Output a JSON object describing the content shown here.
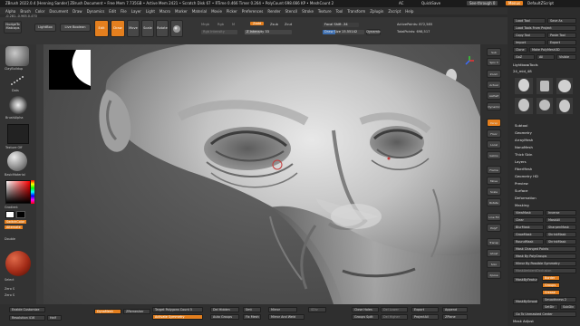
{
  "title_bar": {
    "text": "ZBrush 2022.0.4 [Henning Sander]   ZBrush Document   • Free Mem 7.735GB • Active Mem 2421 • Scratch Disk 67 • RTime 0.466 Timer 0.264 • PolyCount 698.666 KP • MeshCount 2",
    "ac": "AC",
    "quicksave": "QuickSave",
    "see_through": "See-through 0",
    "menus": "Menus",
    "default_script": "DefaultZScript"
  },
  "menu_bar": [
    "Alpha",
    "Brush",
    "Color",
    "Document",
    "Draw",
    "Dynamics",
    "Edit",
    "File",
    "Layer",
    "Light",
    "Macro",
    "Marker",
    "Material",
    "Movie",
    "Picker",
    "Preferences",
    "Render",
    "Stencil",
    "Stroke",
    "Texture",
    "Tool",
    "Transform",
    "Zplugin",
    "Zscript",
    "Help"
  ],
  "status_line": "-0.281,-0.965,0.470",
  "shelf": {
    "nudge_button": "NudgeTo Matcaps",
    "lightbox": "LightBox",
    "live_boolean": "Live Boolean",
    "edit": "Edit",
    "draw": "Draw",
    "move": "Move",
    "scale": "Scale",
    "rotate": "Rotate",
    "mrgb": "Mrgb",
    "rgb": "Rgb",
    "m": "M",
    "zadd": "Zadd",
    "zsub": "Zsub",
    "zcut": "Zcut",
    "rgb_intensity": "Rgb Intensity",
    "z_intensity": "Z Intensity 33",
    "focal_shift": "Focal Shift -34",
    "draw_size": "Draw Size 15.55142",
    "dynamic": "Dynamic",
    "active_points": "ActivePoints: 872,585",
    "total_points": "TotalPoints: 698,517"
  },
  "left_panel": {
    "brush_label": "ClayBuildup",
    "stroke_label": "Dots",
    "alpha_label": "BrushAlpha",
    "texture_label": "Texture Off",
    "material_label": "BasicMaterial",
    "gradient": "Gradient",
    "switch_color": "SwitchColor",
    "alternate": "Alternate",
    "double": "Double",
    "main_color": "#ffffff",
    "secondary_color": "#000000",
    "zero_s": "Zero S",
    "zero_s2": "Zero S"
  },
  "right_strip": [
    "Sub",
    "Spix 3",
    "Zoom",
    "Actual",
    "AAHalf",
    "Dynamic",
    "Persp",
    "Floor",
    "Local",
    "Gizmo",
    "Frame",
    "Move",
    "Scale",
    "Rotate",
    "Line Fill",
    "PolyF",
    "Transp",
    "Ghost",
    "Solo",
    "Xpose"
  ],
  "tool_palette": {
    "top_buttons": [
      "Load Tool",
      "Save As",
      "Load Tools From Project",
      "Copy Tool",
      "Paste Tool",
      "Import",
      "Export",
      "Clone",
      "Make PolyMesh3D",
      "GoZ",
      "All",
      "Visible"
    ],
    "lightbox_tools": "Lightbox▸Tools",
    "current_tool": "24_mid_48",
    "tool_thumbs": [
      "24_mid_48",
      "Cylinder3D",
      "PolyMesh3D",
      "SimpleB",
      "24_mid_48",
      "Skull_Jt"
    ],
    "subpalettes": [
      "Subtool",
      "Geometry",
      "ArrayMesh",
      "NanoMesh",
      "Thick Skin",
      "Layers",
      "FiberMesh",
      "Geometry HD",
      "Preview",
      "Surface",
      "Deformation",
      "Masking"
    ],
    "masking_buttons": [
      "ViewMask",
      "Inverse",
      "Clear",
      "MaskAll",
      "BlurMask",
      "SharpenMask",
      "GrowMask",
      "ShrinkMask",
      "RoundMask",
      "ShrinkMask"
    ],
    "masking_row": "Mask Changed Points",
    "mask_by_poly": "Mask By PolyGroups",
    "mirror": "Mirror By Possible Symmetry",
    "mask_ambient": "MaskAmbientOcclusion",
    "mask_by_feature": "MaskByFeature",
    "border": "Border",
    "groups": "Groups",
    "crease": "Crease",
    "mask_by_smoothness": "MaskBySmoothness",
    "smoothness_val": "Smoothness 2",
    "set_dir": "SetDir",
    "subdiv": "SubDiv",
    "go_to_unmasked": "Go To Unmasked Center",
    "mask_adjust": "Mask Adjust"
  },
  "bottom_bar": {
    "enable_customize": "Enable Customize",
    "resolution": "Resolution 416",
    "half": "Half",
    "dynamesh": "DynaMesh",
    "zremesher": "ZRemesher",
    "target_polygons": "Target Polygons Count 5",
    "activate_symmetry": "Activate Symmetry",
    "del_hidden": "Del Hidden",
    "close_holes": "Close Holes",
    "auto_groups": "Auto Groups",
    "groups_split": "Groups Split",
    "smt": "Smt",
    "mirror": "Mirror",
    "mirror_and_weld": "Mirror And Weld",
    "fix_mesh": "Fix Mesh",
    "sdiv": "SDiv",
    "del_lower": "Del Lower",
    "del_higher": "Del Higher",
    "export": "Export",
    "append": "Append",
    "project_all": "ProjectAll",
    "zplane": "ZPlane"
  }
}
